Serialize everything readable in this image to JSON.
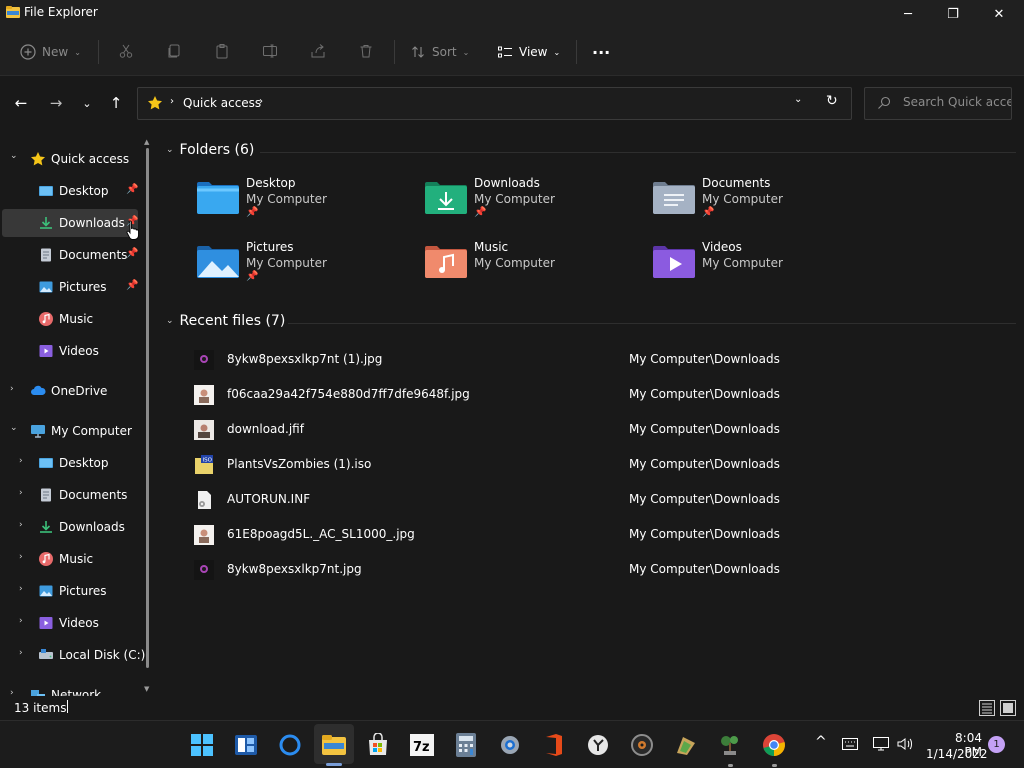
{
  "window": {
    "title": "File Explorer",
    "minimize_glyph": "─",
    "maximize_glyph": "❐",
    "close_glyph": "✕"
  },
  "toolbar": {
    "new_label": "New",
    "sort_label": "Sort",
    "view_label": "View",
    "more_glyph": "···",
    "chevron_glyph": "⌄"
  },
  "nav": {
    "back_glyph": "←",
    "forward_glyph": "→",
    "recent_glyph": "⌄",
    "up_glyph": "↑"
  },
  "address": {
    "separator": "›",
    "location": "Quick access",
    "dropdown_glyph": "⌄",
    "refresh_glyph": "↻"
  },
  "search": {
    "placeholder": "Search Quick access"
  },
  "sidebar": {
    "expanded_glyph": "⌄",
    "collapsed_glyph": "›",
    "pin_glyph": "📌",
    "items": [
      {
        "label": "Quick access",
        "icon": "star-icon",
        "expanded": true
      },
      {
        "label": "Desktop",
        "icon": "desktop-icon",
        "pinned": true
      },
      {
        "label": "Downloads",
        "icon": "downloads-icon",
        "pinned": true,
        "hovered": true
      },
      {
        "label": "Documents",
        "icon": "documents-icon",
        "pinned": true
      },
      {
        "label": "Pictures",
        "icon": "pictures-icon",
        "pinned": true
      },
      {
        "label": "Music",
        "icon": "music-icon"
      },
      {
        "label": "Videos",
        "icon": "videos-icon"
      },
      {
        "label": "OneDrive",
        "icon": "onedrive-icon",
        "expanded": false
      },
      {
        "label": "My Computer",
        "icon": "computer-icon",
        "expanded": true
      },
      {
        "label": "Desktop",
        "icon": "desktop-icon",
        "expanded": false
      },
      {
        "label": "Documents",
        "icon": "documents-icon",
        "expanded": false
      },
      {
        "label": "Downloads",
        "icon": "downloads-icon",
        "expanded": false
      },
      {
        "label": "Music",
        "icon": "music-icon",
        "expanded": false
      },
      {
        "label": "Pictures",
        "icon": "pictures-icon",
        "expanded": false
      },
      {
        "label": "Videos",
        "icon": "videos-icon",
        "expanded": false
      },
      {
        "label": "Local Disk (C:)",
        "icon": "drive-icon",
        "expanded": false
      },
      {
        "label": "Network",
        "icon": "network-icon",
        "expanded": false
      }
    ]
  },
  "folders": {
    "header": "Folders (6)",
    "items": [
      {
        "name": "Desktop",
        "location": "My Computer",
        "pinned": true,
        "icon": "desktop-folder-icon"
      },
      {
        "name": "Downloads",
        "location": "My Computer",
        "pinned": true,
        "icon": "downloads-folder-icon"
      },
      {
        "name": "Documents",
        "location": "My Computer",
        "pinned": true,
        "icon": "documents-folder-icon"
      },
      {
        "name": "Pictures",
        "location": "My Computer",
        "pinned": true,
        "icon": "pictures-folder-icon"
      },
      {
        "name": "Music",
        "location": "My Computer",
        "pinned": false,
        "icon": "music-folder-icon"
      },
      {
        "name": "Videos",
        "location": "My Computer",
        "pinned": false,
        "icon": "videos-folder-icon"
      }
    ]
  },
  "recent": {
    "header": "Recent files (7)",
    "files": [
      {
        "name": "8ykw8pexsxlkp7nt (1).jpg",
        "path": "My Computer\\Downloads",
        "thumb": "jpg-dark-thumbnail"
      },
      {
        "name": "f06caa29a42f754e880d7ff7dfe9648f.jpg",
        "path": "My Computer\\Downloads",
        "thumb": "jpg-photo-thumbnail"
      },
      {
        "name": "download.jfif",
        "path": "My Computer\\Downloads",
        "thumb": "jfif-thumbnail"
      },
      {
        "name": "PlantsVsZombies (1).iso",
        "path": "My Computer\\Downloads",
        "thumb": "iso-file-icon"
      },
      {
        "name": "AUTORUN.INF",
        "path": "My Computer\\Downloads",
        "thumb": "inf-file-icon"
      },
      {
        "name": "61E8poagd5L._AC_SL1000_.jpg",
        "path": "My Computer\\Downloads",
        "thumb": "jpg-photo-thumbnail"
      },
      {
        "name": "8ykw8pexsxlkp7nt.jpg",
        "path": "My Computer\\Downloads",
        "thumb": "jpg-dark-thumbnail"
      }
    ]
  },
  "status": {
    "item_count": "13 items"
  },
  "taskbar": {
    "apps": [
      "start-icon",
      "widgets-icon",
      "cortana-icon",
      "file-explorer-icon",
      "store-icon",
      "7zip-icon",
      "calculator-icon",
      "settings-icon",
      "office-icon",
      "clock-app-icon",
      "disc-icon",
      "plants-vs-zombies-icon",
      "bonsai-icon",
      "chrome-icon"
    ],
    "active_app": "file-explorer-icon",
    "tray_chevron": "^",
    "time": "8:04 PM",
    "date": "1/14/2022",
    "notification_count": "1",
    "seven_zip_label": "7z"
  },
  "colors": {
    "background": "#191919",
    "chrome": "#202020",
    "accent": "#7a9ed8",
    "star": "#f5c518"
  }
}
